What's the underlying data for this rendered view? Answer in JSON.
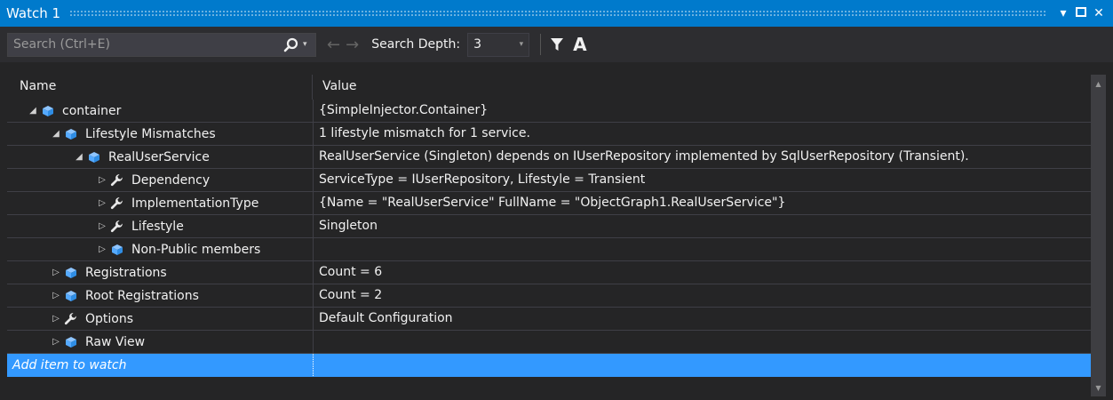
{
  "window": {
    "title": "Watch 1"
  },
  "toolbar": {
    "search_placeholder": "Search (Ctrl+E)",
    "search_depth_label": "Search Depth:",
    "search_depth_value": "3",
    "font_button": "A"
  },
  "columns": {
    "name": "Name",
    "value": "Value"
  },
  "rows": [
    {
      "name": "container",
      "value": "{SimpleInjector.Container}",
      "indent": 0,
      "expanded": true,
      "icon": "object-icon"
    },
    {
      "name": "Lifestyle Mismatches",
      "value": "1 lifestyle mismatch for 1 service.",
      "indent": 1,
      "expanded": true,
      "icon": "object-icon"
    },
    {
      "name": "RealUserService",
      "value": "RealUserService (Singleton) depends on IUserRepository implemented by SqlUserRepository (Transient).",
      "indent": 2,
      "expanded": true,
      "icon": "object-icon"
    },
    {
      "name": "Dependency",
      "value": "ServiceType = IUserRepository, Lifestyle = Transient",
      "indent": 3,
      "expanded": false,
      "icon": "wrench-icon"
    },
    {
      "name": "ImplementationType",
      "value": "{Name = \"RealUserService\" FullName = \"ObjectGraph1.RealUserService\"}",
      "indent": 3,
      "expanded": false,
      "icon": "wrench-icon"
    },
    {
      "name": "Lifestyle",
      "value": "Singleton",
      "indent": 3,
      "expanded": false,
      "icon": "wrench-icon"
    },
    {
      "name": "Non-Public members",
      "value": "",
      "indent": 3,
      "expanded": false,
      "icon": "object-icon"
    },
    {
      "name": "Registrations",
      "value": "Count = 6",
      "indent": 1,
      "expanded": false,
      "icon": "object-icon"
    },
    {
      "name": "Root Registrations",
      "value": "Count = 2",
      "indent": 1,
      "expanded": false,
      "icon": "object-icon"
    },
    {
      "name": "Options",
      "value": "Default Configuration",
      "indent": 1,
      "expanded": false,
      "icon": "wrench-icon"
    },
    {
      "name": "Raw View",
      "value": "",
      "indent": 1,
      "expanded": false,
      "icon": "object-icon"
    }
  ],
  "add_item": {
    "label": "Add item to watch"
  },
  "colors": {
    "accent": "#007acc",
    "selection": "#3399ff",
    "object_icon": "#55aaff",
    "background": "#252526"
  }
}
